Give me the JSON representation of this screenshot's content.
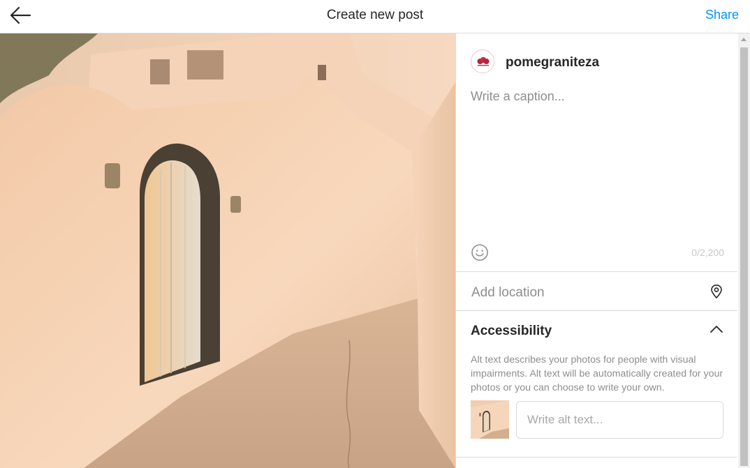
{
  "header": {
    "title": "Create new post",
    "share_label": "Share",
    "back_icon": "arrow-left-icon"
  },
  "composer": {
    "username": "pomegraniteza",
    "caption_placeholder": "Write a caption...",
    "caption_value": "",
    "char_counter": "0/2,200",
    "emoji_icon": "smiley-icon"
  },
  "location": {
    "label": "Add location",
    "icon": "location-pin-icon"
  },
  "accessibility": {
    "label": "Accessibility",
    "expanded": true,
    "description": "Alt text describes your photos for people with visual impairments. Alt text will be automatically created for your photos or you can choose to write your own.",
    "alt_placeholder": "Write alt text...",
    "alt_value": ""
  },
  "colors": {
    "accent": "#0095f6",
    "text": "#262626",
    "muted": "#8e8e8e",
    "border": "#dbdbdb"
  }
}
